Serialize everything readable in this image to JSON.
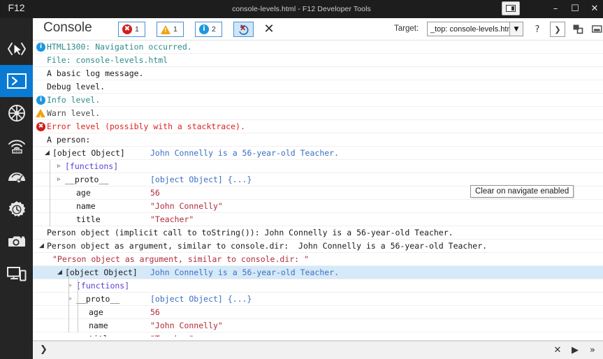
{
  "window": {
    "title": "console-levels.html - F12 Developer Tools",
    "f12_label": "F12",
    "dock_icon": "dock-window-icon",
    "minimize": "–",
    "maximize": "☐",
    "close": "✕"
  },
  "rail": {
    "items": [
      {
        "name": "dom-explorer",
        "label": "DOM Explorer",
        "active": false
      },
      {
        "name": "console",
        "label": "Console",
        "active": true
      },
      {
        "name": "debugger",
        "label": "Debugger",
        "active": false
      },
      {
        "name": "network",
        "label": "Network",
        "active": false
      },
      {
        "name": "performance",
        "label": "Performance",
        "active": false
      },
      {
        "name": "memory",
        "label": "Memory",
        "active": false
      },
      {
        "name": "ui-responsiveness",
        "label": "UI Responsiveness",
        "active": false
      },
      {
        "name": "emulation",
        "label": "Emulation",
        "active": false
      }
    ]
  },
  "toolbar": {
    "panel_title": "Console",
    "error_count": "1",
    "warning_count": "1",
    "info_count": "2",
    "clear_on_navigate_icon": "clear-on-navigate-icon",
    "clear_console_icon": "✕",
    "target_label": "Target:",
    "target_value": "_top: console-levels.htm",
    "target_arrow": "▼",
    "help_icon": "?",
    "console_toggle_icon": "❯",
    "dock_icon": "❐",
    "minimize_icon": "−"
  },
  "tooltip": {
    "text": "Clear on navigate enabled"
  },
  "input_bar": {
    "prompt": "❯",
    "clear_icon": "✕",
    "run_icon": "▶",
    "expand_icon": "»"
  },
  "console": {
    "lines": [
      {
        "icon": "info",
        "indent": 0,
        "text": "HTML1300: Navigation occurred.",
        "color": "c-teal"
      },
      {
        "icon": null,
        "indent": 1,
        "text": "File: console-levels.html",
        "color": "c-teal"
      },
      {
        "icon": null,
        "indent": 1,
        "text": "A basic log message.",
        "color": "c-dark"
      },
      {
        "icon": null,
        "indent": 1,
        "text": "Debug level.",
        "color": "c-dark"
      },
      {
        "icon": "info",
        "indent": 0,
        "text": "Info level.",
        "color": "c-teal"
      },
      {
        "icon": "warn",
        "indent": 0,
        "text": "Warn level.",
        "color": "c-gray"
      },
      {
        "icon": "error",
        "indent": 0,
        "text": "Error level (possibly with a stacktrace).",
        "color": "c-red"
      },
      {
        "icon": null,
        "indent": 1,
        "text": "A person:",
        "color": "c-dark"
      },
      {
        "icon": null,
        "indent": 2,
        "tri": "down",
        "text": "[object Object]",
        "color": "c-dark",
        "value": "John Connelly is a 56-year-old Teacher.",
        "value_color": "c-blue"
      },
      {
        "icon": null,
        "indent": 3,
        "tri": "right",
        "text": "[functions]",
        "color": "c-purple"
      },
      {
        "icon": null,
        "indent": 3,
        "tri": "right",
        "text": "__proto__",
        "color": "c-dark",
        "value": "[object Object] {...}",
        "value_color": "c-blue"
      },
      {
        "icon": null,
        "indent": 4,
        "text": "age",
        "color": "c-dark",
        "value": "56",
        "value_color": "c-crim"
      },
      {
        "icon": null,
        "indent": 4,
        "text": "name",
        "color": "c-dark",
        "value": "\"John Connelly\"",
        "value_color": "c-crim"
      },
      {
        "icon": null,
        "indent": 4,
        "text": "title",
        "color": "c-dark",
        "value": "\"Teacher\"",
        "value_color": "c-crim"
      },
      {
        "icon": null,
        "indent": 0,
        "text": "Person object (implicit call to toString()): John Connelly is a 56-year-old Teacher.",
        "color": "c-dark"
      },
      {
        "icon": null,
        "indent": 1,
        "tri": "down",
        "text": "Person object as argument, similar to console.dir:  John Connelly is a 56-year-old Teacher.",
        "color": "c-dark"
      },
      {
        "icon": null,
        "indent": 2,
        "text": "\"Person object as argument, similar to console.dir: \"",
        "color": "c-crim"
      },
      {
        "icon": null,
        "indent": 3,
        "tri": "down",
        "text": "[object Object]",
        "color": "c-dark",
        "selected": true,
        "value": "John Connelly is a 56-year-old Teacher.",
        "value_color": "c-blue"
      },
      {
        "icon": null,
        "indent": 4,
        "tri": "right",
        "text": "[functions]",
        "color": "c-purple"
      },
      {
        "icon": null,
        "indent": 4,
        "tri": "right",
        "text": "__proto__",
        "color": "c-dark",
        "value": "[object Object] {...}",
        "value_color": "c-blue"
      },
      {
        "icon": null,
        "indent": 5,
        "text": "age",
        "color": "c-dark",
        "value": "56",
        "value_color": "c-crim"
      },
      {
        "icon": null,
        "indent": 5,
        "text": "name",
        "color": "c-dark",
        "value": "\"John Connelly\"",
        "value_color": "c-crim"
      },
      {
        "icon": null,
        "indent": 5,
        "text": "title",
        "color": "c-dark",
        "value": "\"Teacher\"",
        "value_color": "c-crim"
      }
    ]
  },
  "colors": {
    "accent": "#0a7bd4",
    "error": "#d01d1d",
    "warning": "#f0a30a",
    "info": "#1c97e0",
    "selection": "#d6e9f8",
    "rail_bg": "#252526"
  }
}
